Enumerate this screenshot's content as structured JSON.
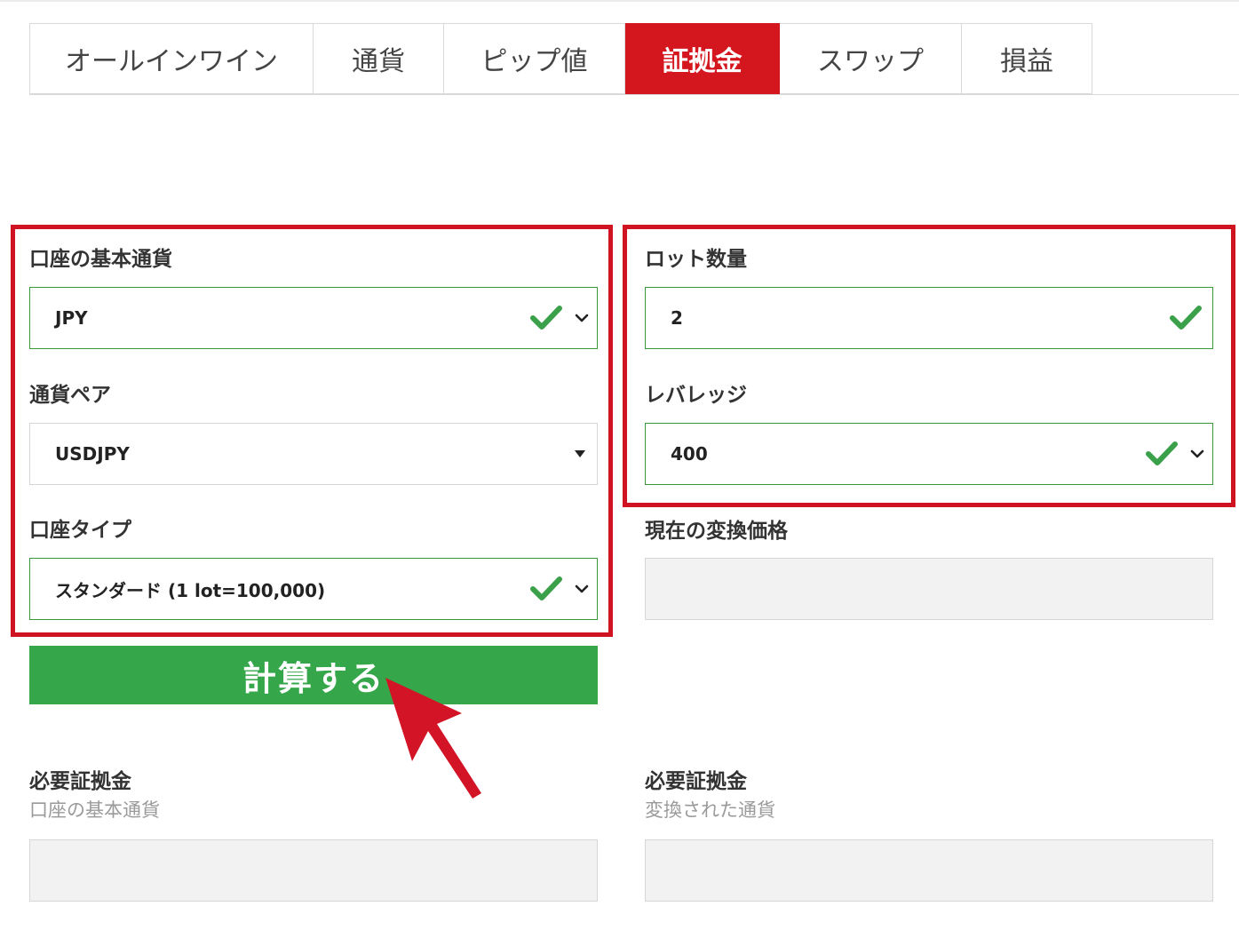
{
  "tabs": [
    {
      "label": "オールインワイン",
      "active": false
    },
    {
      "label": "通貨",
      "active": false
    },
    {
      "label": "ピップ値",
      "active": false
    },
    {
      "label": "証拠金",
      "active": true
    },
    {
      "label": "スワップ",
      "active": false
    },
    {
      "label": "損益",
      "active": false
    }
  ],
  "left": {
    "base_currency": {
      "label": "口座の基本通貨",
      "value": "JPY"
    },
    "pair": {
      "label": "通貨ペア",
      "value": "USDJPY"
    },
    "account_type": {
      "label": "口座タイプ",
      "value": "スタンダード (1 lot=100,000)"
    }
  },
  "right": {
    "lots": {
      "label": "ロット数量",
      "value": "2"
    },
    "leverage": {
      "label": "レバレッジ",
      "value": "400"
    },
    "rate": {
      "label": "現在の変換価格",
      "value": ""
    }
  },
  "calculate_label": "計算する",
  "results": {
    "base": {
      "label": "必要証拠金",
      "sublabel": "口座の基本通貨",
      "value": ""
    },
    "converted": {
      "label": "必要証拠金",
      "sublabel": "変換された通貨",
      "value": ""
    }
  },
  "colors": {
    "accent_red": "#d4161f",
    "highlight_red": "#cf1321",
    "valid_green": "#3a9a3a",
    "button_green": "#35a74a"
  },
  "icons": {
    "valid": "check-icon",
    "dropdown": "chevron-down-icon",
    "select": "caret-down-icon",
    "pointer": "red-arrow-icon"
  }
}
